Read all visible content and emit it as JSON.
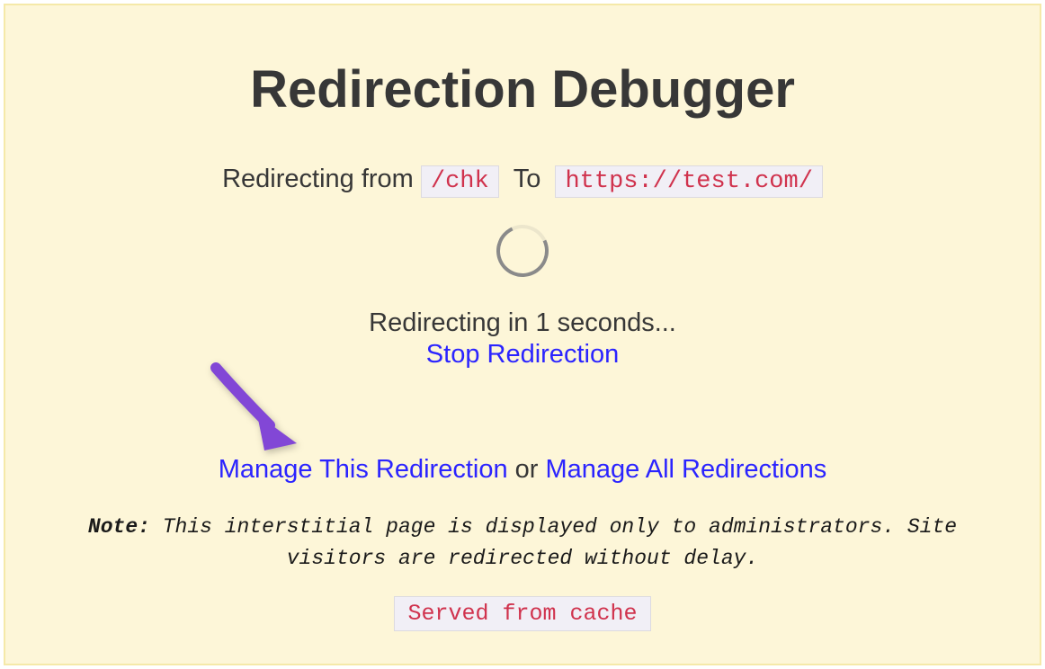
{
  "title": "Redirection Debugger",
  "redirect": {
    "from_label": "Redirecting from",
    "from_value": "/chk",
    "to_label": "To",
    "to_value": "https://test.com/"
  },
  "countdown_text": "Redirecting in 1 seconds...",
  "stop_link": "Stop Redirection",
  "manage": {
    "this_link": "Manage This Redirection",
    "separator": " or ",
    "all_link": "Manage All Redirections"
  },
  "note": {
    "label": "Note:",
    "text": " This interstitial page is displayed only to administrators. Site visitors are redirected without delay."
  },
  "cache_badge": "Served from cache"
}
